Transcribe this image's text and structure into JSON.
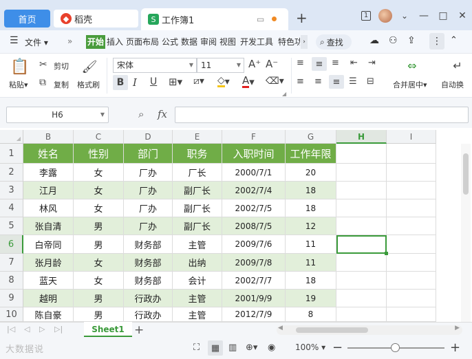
{
  "titlebar": {
    "home_tab": "首页",
    "daoke_tab": "稻壳",
    "workbook_tab": "工作簿1",
    "new_tab_icon": "plus-icon",
    "page_indicator": "1"
  },
  "menubar": {
    "file": "文件",
    "tabs": [
      "开始",
      "插入",
      "页面布局",
      "公式",
      "数据",
      "审阅",
      "视图",
      "开发工具",
      "特色功"
    ],
    "search": "查找"
  },
  "ribbon": {
    "paste": "粘贴",
    "cut": "剪切",
    "copy": "复制",
    "format_painter": "格式刷",
    "font_name": "宋体",
    "font_size": "11",
    "merge_center": "合并居中",
    "auto_wrap": "自动换"
  },
  "formula": {
    "cell_ref": "H6",
    "fx": "fx",
    "value": ""
  },
  "columns": [
    "B",
    "C",
    "D",
    "E",
    "F",
    "G",
    "H",
    "I"
  ],
  "rows": [
    "1",
    "2",
    "3",
    "4",
    "5",
    "6",
    "7",
    "8",
    "9",
    "10"
  ],
  "table": {
    "headers": [
      "姓名",
      "性别",
      "部门",
      "职务",
      "入职时间",
      "工作年限"
    ],
    "rows": [
      [
        "李露",
        "女",
        "厂办",
        "厂长",
        "2000/7/1",
        "20"
      ],
      [
        "江月",
        "女",
        "厂办",
        "副厂长",
        "2002/7/4",
        "18"
      ],
      [
        "林风",
        "女",
        "厂办",
        "副厂长",
        "2002/7/5",
        "18"
      ],
      [
        "张自清",
        "男",
        "厂办",
        "副厂长",
        "2008/7/5",
        "12"
      ],
      [
        "白帝同",
        "男",
        "财务部",
        "主管",
        "2009/7/6",
        "11"
      ],
      [
        "张月龄",
        "女",
        "财务部",
        "出纳",
        "2009/7/8",
        "11"
      ],
      [
        "蓝天",
        "女",
        "财务部",
        "会计",
        "2002/7/7",
        "18"
      ],
      [
        "越明",
        "男",
        "行政办",
        "主管",
        "2001/9/9",
        "19"
      ],
      [
        "陈自豪",
        "男",
        "行政办",
        "主管",
        "2012/7/9",
        "8"
      ]
    ]
  },
  "selected_cell": "H6",
  "sheets": [
    "Sheet1"
  ],
  "status": {
    "zoom": "100%",
    "watermark": "大数据说"
  },
  "colors": {
    "header_green": "#70ad47",
    "band_green": "#e2efda",
    "accent_blue": "#3e8ee8",
    "selection_green": "#3a9a3a"
  }
}
